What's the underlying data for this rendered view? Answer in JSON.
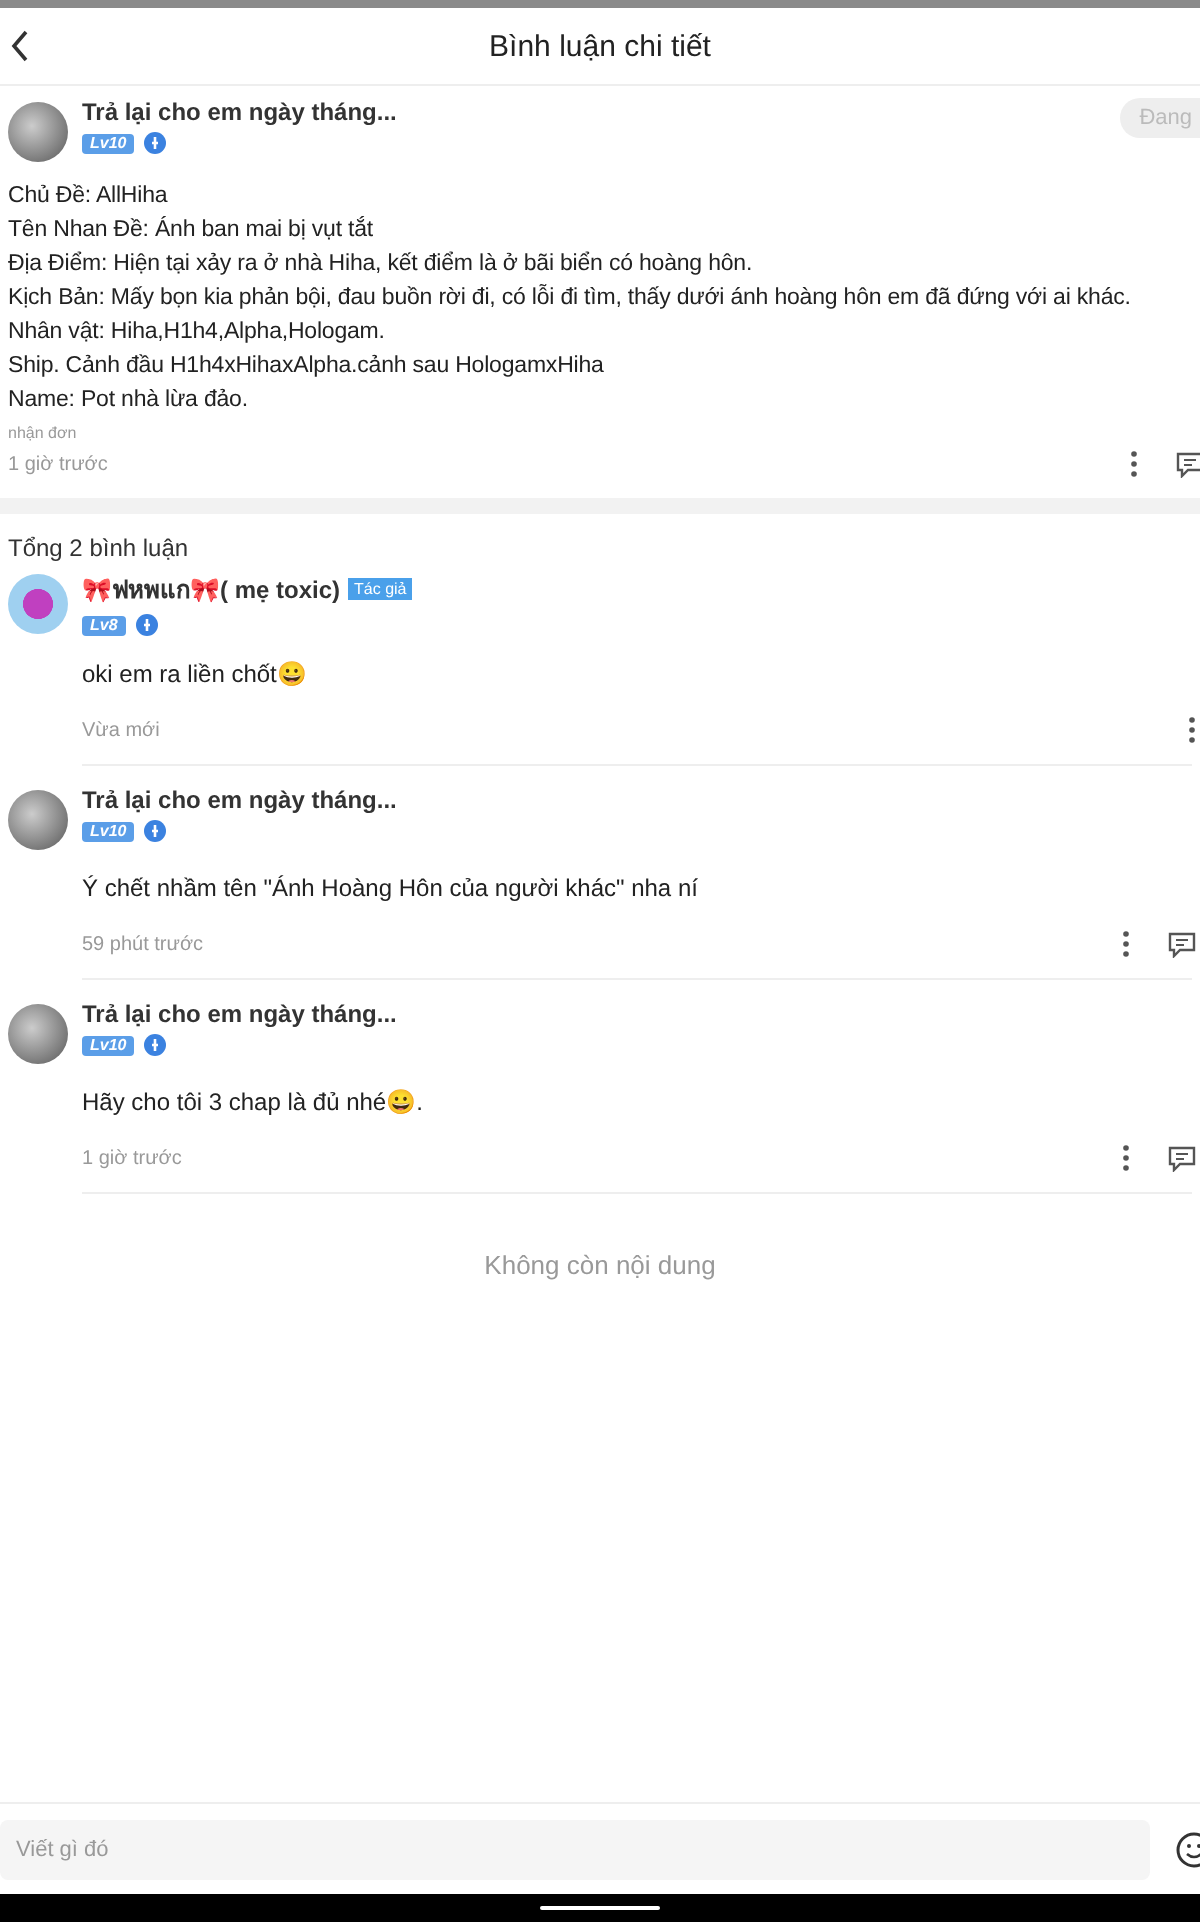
{
  "header": {
    "title": "Bình luận chi tiết"
  },
  "post": {
    "author": "Trả lại cho em ngày tháng...",
    "level": "Lv10",
    "follow_button": "Đang",
    "lines": [
      "Chủ Đề: AllHiha",
      "Tên Nhan Đề: Ánh ban mai bị vụt tắt",
      "Địa Điểm: Hiện tại xảy ra ở nhà Hiha, kết điểm là ở bãi biển có hoàng hôn.",
      "Kịch Bản: Mấy bọn kia phản bội, đau buồn rời đi, có lỗi đi tìm, thấy dưới ánh hoàng hôn em đã đứng với ai khác.",
      "Nhân vật: Hiha,H1h4,Alpha,Hologam.",
      "Ship. Cảnh đầu H1h4xHihaxAlpha.cảnh sau HologamxHiha",
      "Name: Pot nhà lừa đảo."
    ],
    "tag": "nhận đơn",
    "time": "1 giờ trước"
  },
  "comments_total": "Tổng 2 bình luận",
  "comments": [
    {
      "author": "🎀ฟหพแก🎀( mẹ toxic)",
      "author_badge": "Tác giả",
      "level": "Lv8",
      "text": "oki em ra liền chốt😀",
      "time": "Vừa mới",
      "reply_button": false
    },
    {
      "author": "Trả lại cho em ngày tháng...",
      "level": "Lv10",
      "text": "Ý chết nhầm tên \"Ánh Hoàng Hôn của người khác\" nha ní",
      "time": "59 phút trước",
      "reply_button": true
    },
    {
      "author": "Trả lại cho em ngày tháng...",
      "level": "Lv10",
      "text": "Hãy cho tôi 3 chap là đủ nhé😀.",
      "time": "1 giờ trước",
      "reply_button": true
    }
  ],
  "end_note": "Không còn nội dung",
  "input": {
    "placeholder": "Viết gì đó"
  }
}
